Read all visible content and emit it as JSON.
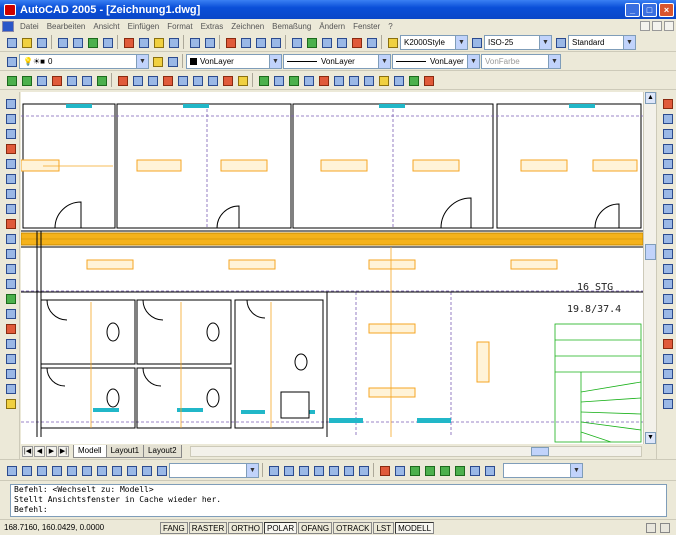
{
  "window": {
    "title": "AutoCAD 2005 - [Zeichnung1.dwg]",
    "min": "_",
    "max": "□",
    "close": "×"
  },
  "menu": [
    "Datei",
    "Bearbeiten",
    "Ansicht",
    "Einfügen",
    "Format",
    "Extras",
    "Zeichnen",
    "Bemaßung",
    "Ändern",
    "Fenster",
    "?"
  ],
  "toolbar1": {
    "text_style": "K2000Style",
    "dim_style": "ISO-25",
    "table_style": "Standard"
  },
  "toolbar2": {
    "layer": "0",
    "color": "VonLayer",
    "linetype": "VonLayer",
    "lineweight": "VonLayer",
    "plotstyle": "VonFarbe"
  },
  "drawing": {
    "label_line1": "16  STG",
    "label_line2": "19.8/37.4"
  },
  "tabs": [
    "Modell",
    "Layout1",
    "Layout2"
  ],
  "active_tab": "Modell",
  "command_lines": [
    "Befehl:  <Wechselt zu: Modell>",
    "Stellt Ansichtsfenster in Cache wieder her.",
    "Befehl:"
  ],
  "status": {
    "coords": "168.7160, 160.0429, 0.0000",
    "toggles": [
      "FANG",
      "RASTER",
      "ORTHO",
      "POLAR",
      "OFANG",
      "OTRACK",
      "LST",
      "MODELL"
    ],
    "on": [
      "POLAR",
      "MODELL"
    ]
  },
  "icons": {
    "app": "autocad-logo-icon",
    "open": "open-file-icon",
    "save": "save-icon",
    "print": "print-icon",
    "undo": "undo-icon",
    "redo": "redo-icon",
    "pan": "pan-icon",
    "zoom": "zoom-icon",
    "layer": "layer-icon",
    "line": "line-tool-icon",
    "circle": "circle-tool-icon",
    "text": "text-tool-icon",
    "erase": "erase-icon",
    "move": "move-icon",
    "rotate": "rotate-icon"
  },
  "colors": {
    "title_bar": "#0a4fd8",
    "accent_beam": "#f5b21b",
    "door_color": "#000000",
    "stair_color": "#18b018",
    "cyan_marker": "#21b7c8",
    "canvas_bg": "#ffffff"
  }
}
